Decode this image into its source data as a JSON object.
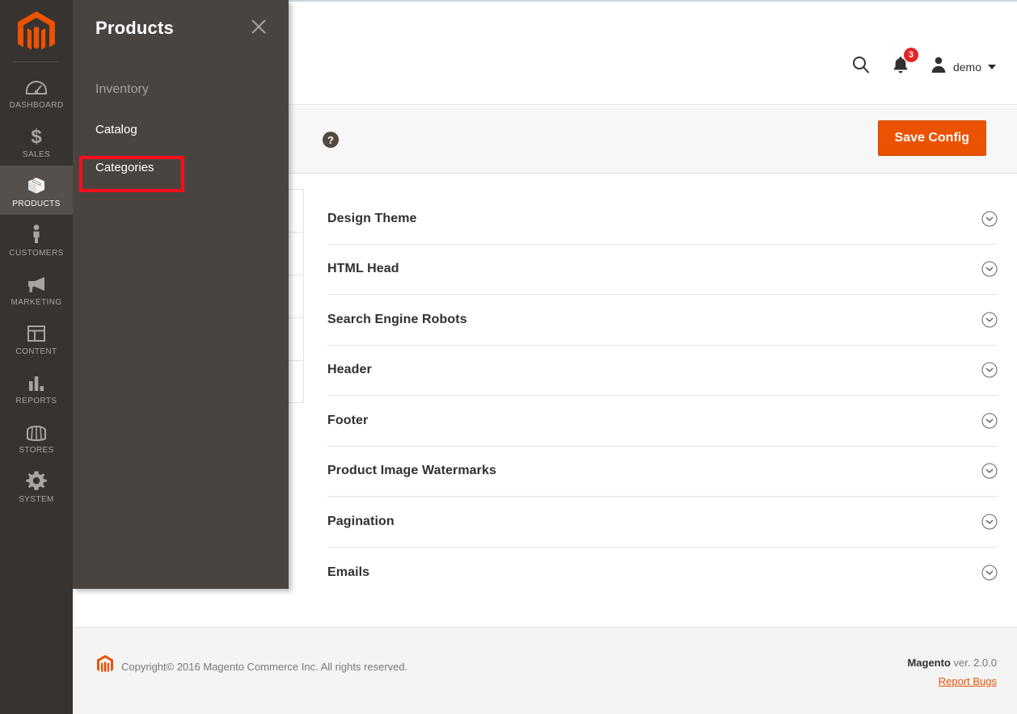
{
  "sidebar": {
    "logo_icon": "magento-logo-icon",
    "items": [
      {
        "label": "DASHBOARD",
        "icon": "dashboard-gauge-icon",
        "active": false
      },
      {
        "label": "SALES",
        "icon": "dollar-sign-icon",
        "active": false
      },
      {
        "label": "PRODUCTS",
        "icon": "box-icon",
        "active": true
      },
      {
        "label": "CUSTOMERS",
        "icon": "person-icon",
        "active": false
      },
      {
        "label": "MARKETING",
        "icon": "megaphone-icon",
        "active": false
      },
      {
        "label": "CONTENT",
        "icon": "layout-icon",
        "active": false
      },
      {
        "label": "REPORTS",
        "icon": "bar-chart-icon",
        "active": false
      },
      {
        "label": "STORES",
        "icon": "storefront-icon",
        "active": false
      },
      {
        "label": "SYSTEM",
        "icon": "gear-icon",
        "active": false
      }
    ]
  },
  "flyout": {
    "title": "Products",
    "close_icon": "close-icon",
    "section_title": "Inventory",
    "links": [
      {
        "label": "Catalog",
        "highlighted": false
      },
      {
        "label": "Categories",
        "highlighted": true
      }
    ],
    "highlight_color": "#fc0d1b"
  },
  "header": {
    "search_icon": "search-icon",
    "notifications_icon": "bell-icon",
    "notifications_count": "3",
    "user_icon": "user-avatar-icon",
    "user_name": "demo",
    "caret_icon": "chevron-down-icon"
  },
  "actions": {
    "help_icon": "help-question-icon",
    "save_label": "Save Config",
    "save_color": "#eb5202"
  },
  "config_nav": {
    "items": [
      {
        "label": ""
      },
      {
        "label": ""
      },
      {
        "label": ""
      },
      {
        "label": ""
      },
      {
        "label": ""
      }
    ]
  },
  "sections": [
    {
      "title": "Design Theme",
      "toggle_icon": "chevron-down-circle-icon"
    },
    {
      "title": "HTML Head",
      "toggle_icon": "chevron-down-circle-icon"
    },
    {
      "title": "Search Engine Robots",
      "toggle_icon": "chevron-down-circle-icon"
    },
    {
      "title": "Header",
      "toggle_icon": "chevron-down-circle-icon"
    },
    {
      "title": "Footer",
      "toggle_icon": "chevron-down-circle-icon"
    },
    {
      "title": "Product Image Watermarks",
      "toggle_icon": "chevron-down-circle-icon"
    },
    {
      "title": "Pagination",
      "toggle_icon": "chevron-down-circle-icon"
    },
    {
      "title": "Emails",
      "toggle_icon": "chevron-down-circle-icon"
    }
  ],
  "footer": {
    "logo_icon": "magento-logo-icon",
    "copyright": "Copyright© 2016 Magento Commerce Inc. All rights reserved.",
    "brand": "Magento",
    "version": " ver. 2.0.0",
    "report_bugs": "Report Bugs",
    "link_color": "#eb5202"
  }
}
